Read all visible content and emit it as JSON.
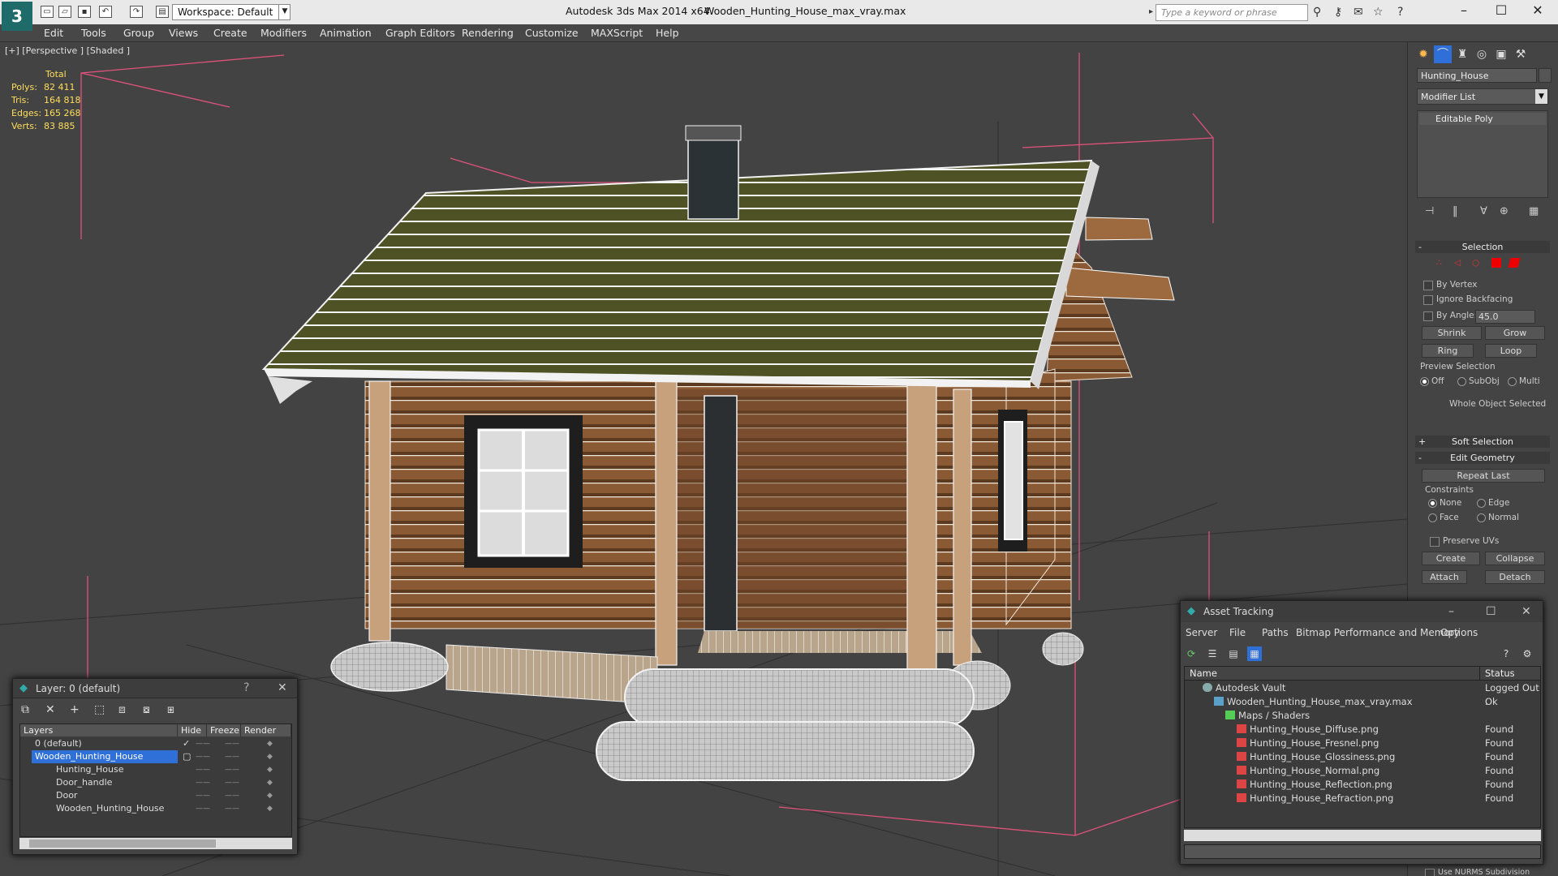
{
  "titlebar": {
    "workspace": "Workspace: Default",
    "app_title": "Autodesk 3ds Max  2014 x64",
    "file_title": "Wooden_Hunting_House_max_vray.max",
    "search_placeholder": "Type a keyword or phrase"
  },
  "menu": [
    "Edit",
    "Tools",
    "Group",
    "Views",
    "Create",
    "Modifiers",
    "Animation",
    "Graph Editors",
    "Rendering",
    "Customize",
    "MAXScript",
    "Help"
  ],
  "viewport": {
    "label": "[+] [Perspective ] [Shaded ]",
    "stats": {
      "header": "Total",
      "rows": [
        {
          "label": "Polys:",
          "value": "82 411"
        },
        {
          "label": "Tris:",
          "value": "164 818"
        },
        {
          "label": "Edges:",
          "value": "165 268"
        },
        {
          "label": "Verts:",
          "value": "83 885"
        }
      ]
    }
  },
  "command_panel": {
    "object_name": "Hunting_House",
    "modifier_list": "Modifier List",
    "stack_item": "Editable Poly",
    "selection": {
      "title": "Selection",
      "by_vertex": "By Vertex",
      "ignore_backfacing": "Ignore Backfacing",
      "by_angle": "By Angle:",
      "angle_value": "45.0",
      "shrink": "Shrink",
      "grow": "Grow",
      "ring": "Ring",
      "loop": "Loop",
      "preview_label": "Preview Selection",
      "preview_off": "Off",
      "preview_subobj": "SubObj",
      "preview_multi": "Multi",
      "status": "Whole Object Selected"
    },
    "soft_selection": "Soft Selection",
    "edit_geometry": {
      "title": "Edit Geometry",
      "repeat_last": "Repeat Last",
      "constraints": "Constraints",
      "none": "None",
      "edge": "Edge",
      "face": "Face",
      "normal": "Normal",
      "preserve_uvs": "Preserve UVs",
      "create": "Create",
      "collapse": "Collapse",
      "attach": "Attach",
      "detach": "Detach"
    },
    "use_nurms": "Use NURMS Subdivision"
  },
  "layers_dialog": {
    "title": "Layer: 0 (default)",
    "help": "?",
    "columns": [
      "Layers",
      "Hide",
      "Freeze",
      "Render"
    ],
    "rows": [
      {
        "name": "0 (default)",
        "indent": 0,
        "selected": false
      },
      {
        "name": "Wooden_Hunting_House",
        "indent": 0,
        "selected": true
      },
      {
        "name": "Hunting_House",
        "indent": 1,
        "selected": false
      },
      {
        "name": "Door_handle",
        "indent": 1,
        "selected": false
      },
      {
        "name": "Door",
        "indent": 1,
        "selected": false
      },
      {
        "name": "Wooden_Hunting_House",
        "indent": 1,
        "selected": false
      }
    ],
    "cell_mark": "——"
  },
  "asset_dialog": {
    "title": "Asset Tracking",
    "menu": [
      "Server",
      "File",
      "Paths",
      "Bitmap Performance and Memory",
      "Options"
    ],
    "columns": [
      "Name",
      "Status"
    ],
    "rows": [
      {
        "name": "Autodesk Vault",
        "status": "Logged Out .",
        "level": 0,
        "icon": "vault-icon"
      },
      {
        "name": "Wooden_Hunting_House_max_vray.max",
        "status": "Ok",
        "level": 1,
        "icon": "max-file-icon"
      },
      {
        "name": "Maps / Shaders",
        "status": "",
        "level": 2,
        "icon": "maps-icon"
      },
      {
        "name": "Hunting_House_Diffuse.png",
        "status": "Found",
        "level": 3,
        "icon": "png-icon"
      },
      {
        "name": "Hunting_House_Fresnel.png",
        "status": "Found",
        "level": 3,
        "icon": "png-icon"
      },
      {
        "name": "Hunting_House_Glossiness.png",
        "status": "Found",
        "level": 3,
        "icon": "png-icon"
      },
      {
        "name": "Hunting_House_Normal.png",
        "status": "Found",
        "level": 3,
        "icon": "png-icon"
      },
      {
        "name": "Hunting_House_Reflection.png",
        "status": "Found",
        "level": 3,
        "icon": "png-icon"
      },
      {
        "name": "Hunting_House_Refraction.png",
        "status": "Found",
        "level": 3,
        "icon": "png-icon"
      }
    ]
  },
  "colors": {
    "viewport_bg": "#434343",
    "stats_text": "#ffde5a",
    "selection_blue": "#2f6fd8",
    "wood": "#8a5a34",
    "roof": "#4f5224"
  }
}
